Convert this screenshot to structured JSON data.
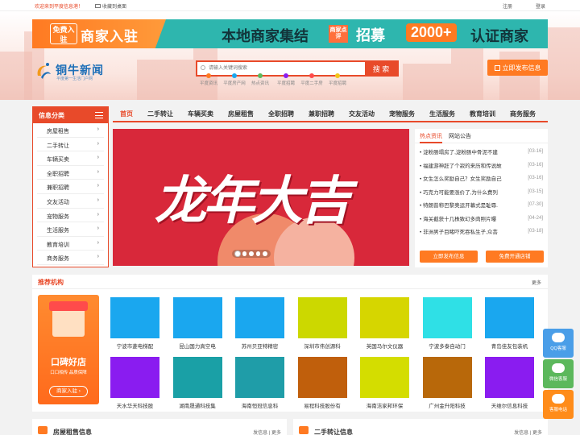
{
  "topbar": {
    "welcome": "欢迎来到平度信息港！",
    "bookmark": "收藏到桌面",
    "register": "注册",
    "login": "登录"
  },
  "banner": {
    "free": "免费入驻",
    "join": "商家入驻",
    "local": "本地商家集结",
    "stamp": "商家点评",
    "recruit": "招募",
    "count": "2000+",
    "cert": "认证商家"
  },
  "logo": {
    "name": "铜牛新闻",
    "slogan": "平度第一生活门户网"
  },
  "search": {
    "placeholder": "请输入关键词搜索",
    "button": "搜 索"
  },
  "hotwords": [
    "平度资讯",
    "平度房产网",
    "热点资讯",
    "平度招聘",
    "平度二手房",
    "平度招聘"
  ],
  "publish": "立即发布信息",
  "categories": {
    "title": "信息分类",
    "items": [
      "房屋租售",
      "二手转让",
      "车辆买卖",
      "全职招聘",
      "兼职招聘",
      "交友活动",
      "宠物服务",
      "生活服务",
      "教育培训",
      "商务服务"
    ]
  },
  "nav": [
    "首页",
    "二手转让",
    "车辆买卖",
    "房屋租售",
    "全职招聘",
    "兼职招聘",
    "交友活动",
    "宠物服务",
    "生活服务",
    "教育培训",
    "商务服务"
  ],
  "slide": {
    "text": "龙年大吉"
  },
  "hot": {
    "tab_hot": "热点资讯",
    "tab_notice": "网站公告",
    "items": [
      {
        "title": "淀粉肠塌房了,淀粉肠中骨泥不建",
        "date": "[03-16]"
      },
      {
        "title": "福建游神赶了个寂的来历和传说故",
        "date": "[03-16]"
      },
      {
        "title": "女生怎么奖励自己？女生奖励自己",
        "date": "[03-16]"
      },
      {
        "title": "巧克力可能要涨价了,为什么费列",
        "date": "[03-15]"
      },
      {
        "title": "特朗普称巴黎奥运开幕式是耻辱.",
        "date": "[07-30]"
      },
      {
        "title": "海关截获十几株致幻多肉照片曝",
        "date": "[04-24]"
      },
      {
        "title": "非洲男子目睹吓死吞私生子,众菩",
        "date": "[03-18]"
      }
    ],
    "btn_post": "立即发布信息",
    "btn_shop": "免费开通店铺"
  },
  "recommend": {
    "title": "推荐机构",
    "more": "更多",
    "card": {
      "k": "口碑好店",
      "s": "口口相传 品质保障",
      "btn": "商家入驻 ›"
    },
    "tiles": [
      {
        "name": "宁波市菱电梯配",
        "color": "#1aa7ef"
      },
      {
        "name": "昆山国力真空电",
        "color": "#1aa7ef"
      },
      {
        "name": "苏州贝亚特精密",
        "color": "#1aa7ef"
      },
      {
        "name": "深圳市伟创源科",
        "color": "#ccd800"
      },
      {
        "name": "英国马尔文仪器",
        "color": "#d6d600"
      },
      {
        "name": "宁波多泰自动门",
        "color": "#2fe0e6"
      },
      {
        "name": "青岛佳友包装机",
        "color": "#1aa7ef"
      },
      {
        "name": "天水华天科技股",
        "color": "#8a1cf0"
      },
      {
        "name": "湖南晟通科技集",
        "color": "#1aa0a6"
      },
      {
        "name": "海南恒冠信息科",
        "color": "#1f9da8"
      },
      {
        "name": "易程科技股份有",
        "color": "#c05f0c"
      },
      {
        "name": "海南洁家邦环保",
        "color": "#d4dd00"
      },
      {
        "name": "广州金升阳科技",
        "color": "#b8680a"
      },
      {
        "name": "天维尔信息科技",
        "color": "#8a1cf0"
      }
    ]
  },
  "sidebar": {
    "qq": "QQ客服",
    "wechat": "微信客服",
    "phone": "客服电话"
  },
  "bottom": [
    {
      "title": "房屋租售信息",
      "links": "发信息 | 更多"
    },
    {
      "title": "二手转让信息",
      "links": "发信息 | 更多"
    }
  ]
}
